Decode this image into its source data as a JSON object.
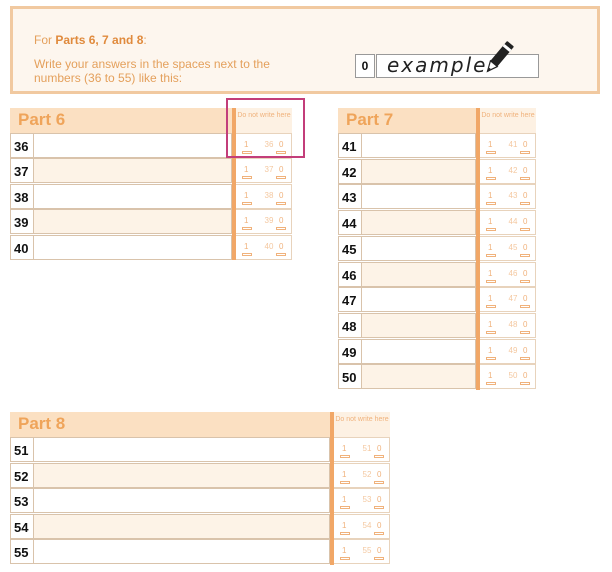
{
  "instructions": {
    "prefix": "For ",
    "parts_bold": "Parts 6, 7 and 8",
    "suffix": ":",
    "line2": "Write your answers in the spaces next to the numbers (36 to 55) like this:"
  },
  "example": {
    "number": "0",
    "word": "example",
    "icon": "pen-icon"
  },
  "do_not_write": "Do not write here",
  "mark_one": "1",
  "mark_zero": "0",
  "part6": {
    "title": "Part 6",
    "numbers": [
      "36",
      "37",
      "38",
      "39",
      "40"
    ]
  },
  "part7": {
    "title": "Part 7",
    "numbers": [
      "41",
      "42",
      "43",
      "44",
      "45",
      "46",
      "47",
      "48",
      "49",
      "50"
    ]
  },
  "part8": {
    "title": "Part 8",
    "numbers": [
      "51",
      "52",
      "53",
      "54",
      "55"
    ]
  },
  "colors": {
    "accent": "#efa45a",
    "band": "#fbe0c2",
    "highlight": "#c33e7a"
  }
}
